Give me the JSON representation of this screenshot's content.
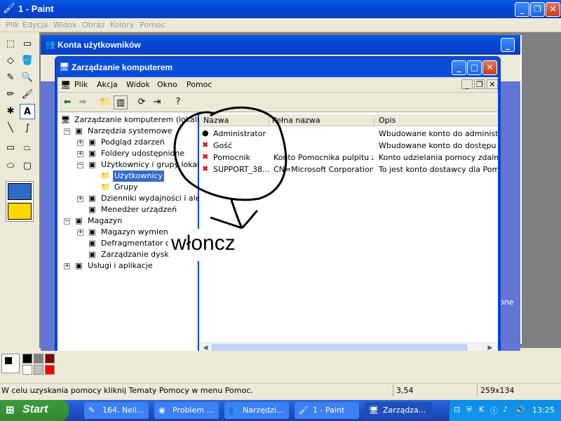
{
  "paint": {
    "title": "1 - Paint",
    "menu": [
      "Plik",
      "Edycja",
      "Widok",
      "Obraz",
      "Kolory",
      "Pomoc"
    ],
    "status_help": "W celu uzyskania pomocy kliknij Tematy Pomocy w menu Pomoc.",
    "coords": "3,54",
    "size": "259x134",
    "edge_text": "one",
    "handwriting": "włoncz"
  },
  "konta": {
    "title": "Konta użytkowników"
  },
  "zarzadzanie": {
    "title": "Zarządzanie komputerem",
    "menu": [
      "Plik",
      "Akcja",
      "Widok",
      "Okno",
      "Pomoc"
    ],
    "tree": [
      {
        "label": "Zarządzanie komputerem (lokalne)",
        "level": 0,
        "exp": "",
        "icon": "computer-icon"
      },
      {
        "label": "Narzędzia systemowe",
        "level": 1,
        "exp": "−",
        "icon": "tools-icon"
      },
      {
        "label": "Podgląd zdarzeń",
        "level": 2,
        "exp": "+",
        "icon": "event-viewer-icon"
      },
      {
        "label": "Foldery udostępnione",
        "level": 2,
        "exp": "+",
        "icon": "shared-folder-icon"
      },
      {
        "label": "Użytkownicy i grupy lokalne",
        "level": 2,
        "exp": "−",
        "icon": "users-icon"
      },
      {
        "label": "Użytkownicy",
        "level": 3,
        "exp": "",
        "icon": "folder-icon",
        "selected": true
      },
      {
        "label": "Grupy",
        "level": 3,
        "exp": "",
        "icon": "folder-icon"
      },
      {
        "label": "Dzienniki wydajności i alerty",
        "level": 2,
        "exp": "+",
        "icon": "performance-icon"
      },
      {
        "label": "Menedżer urządzeń",
        "level": 2,
        "exp": "",
        "icon": "device-manager-icon"
      },
      {
        "label": "Magazyn",
        "level": 1,
        "exp": "−",
        "icon": "storage-icon"
      },
      {
        "label": "Magazyn wymienny",
        "level": 2,
        "exp": "+",
        "icon": "removable-storage-icon"
      },
      {
        "label": "Defragmentator dysków",
        "level": 2,
        "exp": "",
        "icon": "defrag-icon"
      },
      {
        "label": "Zarządzanie dyskami",
        "level": 2,
        "exp": "",
        "icon": "disk-management-icon"
      },
      {
        "label": "Usługi i aplikacje",
        "level": 1,
        "exp": "+",
        "icon": "services-icon"
      }
    ],
    "columns": [
      "Nazwa",
      "Pełna nazwa",
      "Opis"
    ],
    "users": [
      {
        "name": "Administrator",
        "full": "",
        "desc": "Wbudowane konto do administrowa",
        "disabled": false
      },
      {
        "name": "Gość",
        "full": "",
        "desc": "Wbudowane konto do dostępu do k",
        "disabled": true
      },
      {
        "name": "Pomocnik",
        "full": "Konto Pomocnika pulpitu z...",
        "desc": "Konto udzielania pomocy zdalnej",
        "disabled": true
      },
      {
        "name": "SUPPORT_38...",
        "full": "CN=Microsoft Corporation...",
        "desc": "To jest konto dostawcy dla Pomocy",
        "disabled": true
      }
    ]
  },
  "taskbar": {
    "start": "Start",
    "tasks": [
      "164. Nell...",
      "Problem ...",
      "Narzędzi...",
      "1 - Paint",
      "Zarządza..."
    ],
    "clock": "13:25"
  },
  "colors": {
    "xp_blue": "#0a4ed8",
    "selection": "#316ac5",
    "taskbar": "#245edb",
    "start_green": "#3c9a3c"
  }
}
